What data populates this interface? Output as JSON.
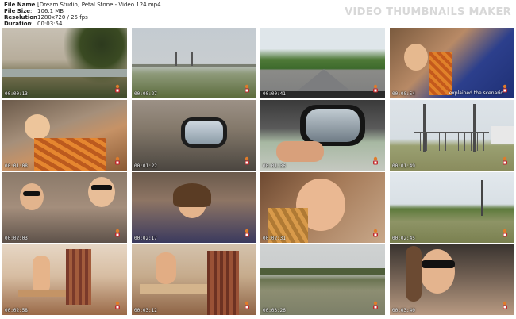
{
  "file": {
    "name_label": "File Name",
    "name_value": "[Dream Studio] Petal Stone - Video 124.mp4",
    "size_label": "File Size",
    "size_value": "106.1 MB",
    "resolution_label": "Resolution",
    "resolution_value": "1280x720 / 25 fps",
    "duration_label": "Duration",
    "duration_value": "00:03:54",
    "separator": ":"
  },
  "brand": {
    "title": "VIDEO THUMBNAILS MAKER"
  },
  "thumbnails": [
    {
      "time": "00:00:13"
    },
    {
      "time": "00:00:27"
    },
    {
      "time": "00:00:41"
    },
    {
      "time": "00:00:54",
      "caption": "explained the scenario"
    },
    {
      "time": "00:01:08"
    },
    {
      "time": "00:01:22"
    },
    {
      "time": "00:01:36"
    },
    {
      "time": "00:01:49"
    },
    {
      "time": "00:02:03"
    },
    {
      "time": "00:02:17"
    },
    {
      "time": "00:02:31"
    },
    {
      "time": "00:02:45"
    },
    {
      "time": "00:02:58"
    },
    {
      "time": "00:03:12"
    },
    {
      "time": "00:03:26"
    },
    {
      "time": "00:03:40"
    }
  ]
}
